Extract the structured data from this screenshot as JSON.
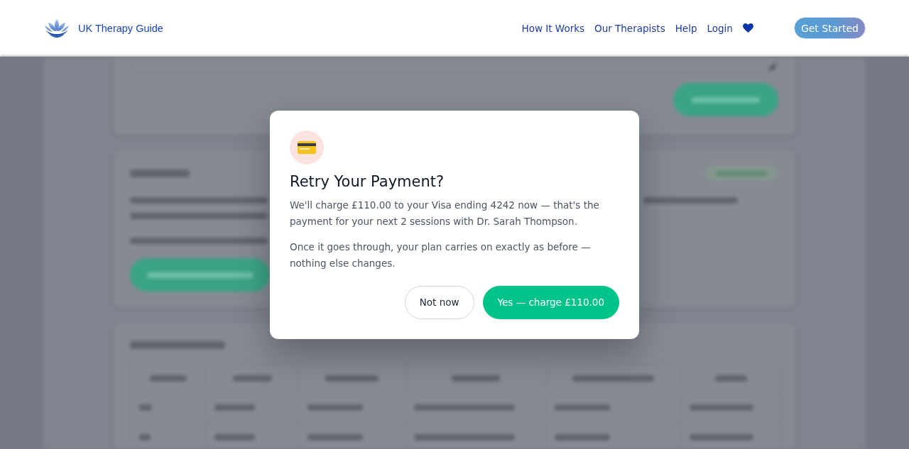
{
  "header": {
    "brand": "UK Therapy Guide",
    "nav": [
      "How It Works",
      "Our Therapists",
      "Help",
      "Login"
    ],
    "cta": "Get Started"
  },
  "dialog": {
    "title": "Retry Your Payment?",
    "paragraphs": [
      "We'll charge £110.00 to your Visa ending 4242 now — that's the payment for your next 2 sessions with Dr. Sarah Thompson.",
      "Once it goes through, your plan carries on exactly as before — nothing else changes."
    ],
    "buttons": [
      {
        "label": "Not now",
        "kind": "secondary"
      },
      {
        "label": "Yes — charge £110.00",
        "kind": "primary"
      }
    ]
  }
}
